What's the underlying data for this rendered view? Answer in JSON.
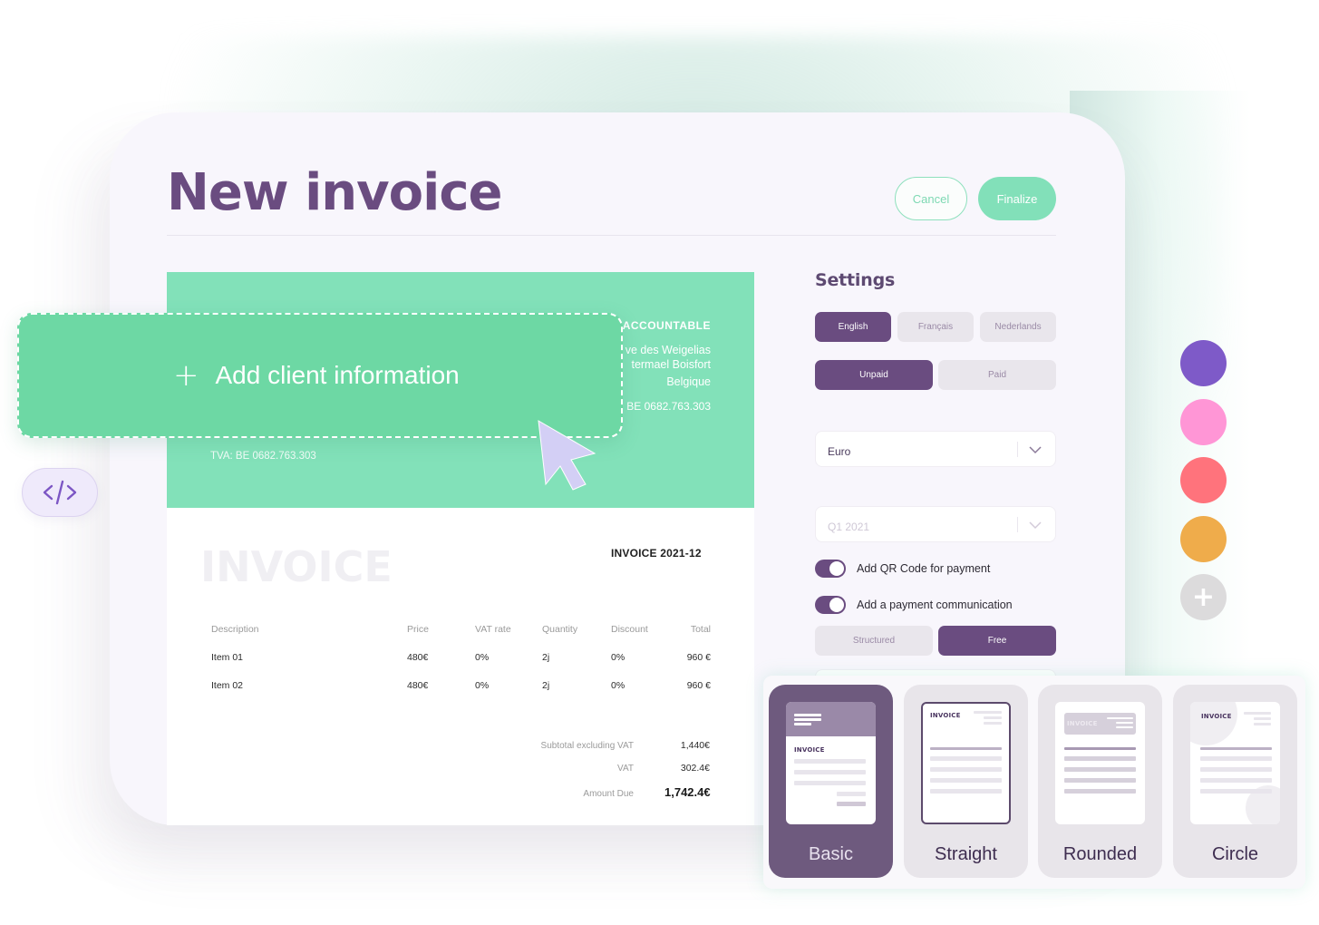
{
  "header": {
    "title": "New invoice",
    "cancel_label": "Cancel",
    "finalize_label": "Finalize"
  },
  "invoice": {
    "company": {
      "name": "ACCOUNTABLE",
      "address_line1": "ve des Weigelias",
      "address_line2": "termael Boisfort",
      "country": "Belgique",
      "vat": "BE 0682.763.303"
    },
    "client_vat": "TVA: BE 0682.763.303",
    "watermark": "INVOICE",
    "number": "INVOICE 2021-12",
    "columns": [
      "Description",
      "Price",
      "VAT rate",
      "Quantity",
      "Discount",
      "Total"
    ],
    "items": [
      {
        "description": "Item 01",
        "price": "480€",
        "vat_rate": "0%",
        "quantity": "2j",
        "discount": "0%",
        "total": "960 €"
      },
      {
        "description": "Item 02",
        "price": "480€",
        "vat_rate": "0%",
        "quantity": "2j",
        "discount": "0%",
        "total": "960 €"
      }
    ],
    "totals": [
      {
        "label": "Subtotal excluding VAT",
        "value": "1,440€"
      },
      {
        "label": "VAT",
        "value": "302.4€"
      },
      {
        "label": "Amount Due",
        "value": "1,742.4€"
      }
    ]
  },
  "add_client": {
    "icon": "plus-icon",
    "label": "Add client information"
  },
  "code_button": {
    "icon": "code-icon"
  },
  "settings": {
    "title": "Settings",
    "languages": [
      {
        "label": "English",
        "selected": true
      },
      {
        "label": "Français",
        "selected": false
      },
      {
        "label": "Nederlands",
        "selected": false
      }
    ],
    "status": [
      {
        "label": "Unpaid",
        "selected": true
      },
      {
        "label": "Paid",
        "selected": false
      }
    ],
    "currency": {
      "value": "Euro"
    },
    "period": {
      "placeholder": "Q1 2021"
    },
    "toggles": [
      {
        "label": "Add QR Code for payment",
        "on": true
      },
      {
        "label": "Add a payment communication",
        "on": true
      }
    ],
    "communication_type": [
      {
        "label": "Structured",
        "selected": false
      },
      {
        "label": "Free",
        "selected": true
      }
    ]
  },
  "colors": {
    "swatches": [
      "#7e5ac8",
      "#ff96d6",
      "#ff737c",
      "#efac4b"
    ],
    "add_icon": "plus-icon",
    "primary": "#6a4c80",
    "accent": "#82e1b9"
  },
  "templates": [
    {
      "name": "Basic",
      "selected": true,
      "preview_label": "INVOICE"
    },
    {
      "name": "Straight",
      "selected": false,
      "preview_label": "INVOICE"
    },
    {
      "name": "Rounded",
      "selected": false,
      "preview_label": "INVOICE"
    },
    {
      "name": "Circle",
      "selected": false,
      "preview_label": "INVOICE"
    }
  ]
}
